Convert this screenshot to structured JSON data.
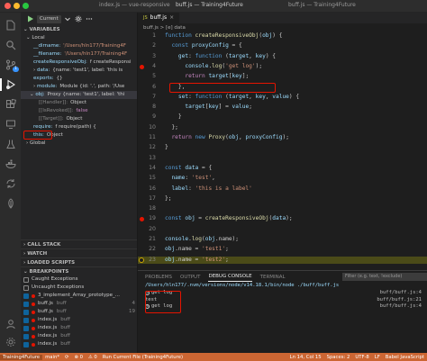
{
  "window": {
    "title_left": "index.js — vue-responsive",
    "title_center": "buff.js — Training4Future",
    "title_right": "buff.js — Training4Future"
  },
  "activity": {
    "items": [
      "files-icon",
      "search-icon",
      "source-control-icon",
      "run-debug-icon",
      "extensions-icon",
      "remote-icon",
      "testing-icon",
      "docker-icon",
      "settings-sync-icon",
      "leaf-icon"
    ],
    "badge": "1"
  },
  "debug_toolbar": {
    "config_label": "Current"
  },
  "variables": {
    "header": "VARIABLES",
    "local_label": "Local",
    "rows": [
      {
        "key": "__dirname:",
        "val": "'/Users/hln177/Training4F"
      },
      {
        "key": "__filename:",
        "val": "'/Users/hln177/Training4F"
      },
      {
        "key": "createResponsiveObj:",
        "val": "f createResponsi"
      },
      {
        "key": "data:",
        "val": "{name: 'test1', label: 'this is"
      },
      {
        "key": "exports:",
        "val": "{}"
      },
      {
        "key": "module:",
        "val": "Module {id: '.', path: '/Use"
      },
      {
        "key": "obj:",
        "val": "Proxy {name: 'test1', label: 'thi"
      },
      {
        "key": "[[Handler]]:",
        "val": "Object"
      },
      {
        "key": "[[IsRevoked]]:",
        "val": "false"
      },
      {
        "key": "[[Target]]:",
        "val": "Object"
      },
      {
        "key": "require:",
        "val": "f require(path) {"
      },
      {
        "key": "this:",
        "val": "Object"
      }
    ],
    "global_label": "Global"
  },
  "sections": {
    "call_stack": "CALL STACK",
    "watch": "WATCH",
    "loaded_scripts": "LOADED SCRIPTS",
    "breakpoints": "BREAKPOINTS"
  },
  "breakpoints": [
    {
      "name": "Caught Exceptions",
      "path": "",
      "line": "",
      "checked": false,
      "dot": false
    },
    {
      "name": "Uncaught Exceptions",
      "path": "",
      "line": "",
      "checked": false,
      "dot": false
    },
    {
      "name": "3_implement_Array_prototype_...",
      "path": "",
      "line": "",
      "checked": true,
      "dot": true
    },
    {
      "name": "buff.js",
      "path": "buff",
      "line": "4",
      "checked": true,
      "dot": true
    },
    {
      "name": "buff.js",
      "path": "buff",
      "line": "19",
      "checked": true,
      "dot": true
    },
    {
      "name": "index.js",
      "path": "buff",
      "line": "",
      "checked": true,
      "dot": true
    },
    {
      "name": "index.js",
      "path": "buff",
      "line": "",
      "checked": true,
      "dot": true
    },
    {
      "name": "index.js",
      "path": "buff",
      "line": "",
      "checked": true,
      "dot": true
    },
    {
      "name": "index.js",
      "path": "buff",
      "line": "",
      "checked": true,
      "dot": true
    }
  ],
  "editor": {
    "tab_label": "buff.js",
    "breadcrumb": "buff.js > [e] data",
    "lines": [
      {
        "n": "1",
        "code": "function createResponsiveObj(obj) {"
      },
      {
        "n": "2",
        "code": "  const proxyConfig = {"
      },
      {
        "n": "3",
        "code": "    get: function (target, key) {"
      },
      {
        "n": "4",
        "code": "      console.log('get log');"
      },
      {
        "n": "5",
        "code": "      return target[key];"
      },
      {
        "n": "6",
        "code": "    },"
      },
      {
        "n": "7",
        "code": "    set: function (target, key, value) {"
      },
      {
        "n": "8",
        "code": "      target[key] = value;"
      },
      {
        "n": "9",
        "code": "    }"
      },
      {
        "n": "10",
        "code": "  };"
      },
      {
        "n": "11",
        "code": "  return new Proxy(obj, proxyConfig);"
      },
      {
        "n": "12",
        "code": "}"
      },
      {
        "n": "13",
        "code": ""
      },
      {
        "n": "14",
        "code": "const data = {"
      },
      {
        "n": "15",
        "code": "  name: 'test',"
      },
      {
        "n": "16",
        "code": "  label: 'this is a label'"
      },
      {
        "n": "17",
        "code": "};"
      },
      {
        "n": "18",
        "code": ""
      },
      {
        "n": "19",
        "code": "const obj = createResponsiveObj(data);"
      },
      {
        "n": "20",
        "code": ""
      },
      {
        "n": "21",
        "code": "console.log(obj.name);"
      },
      {
        "n": "22",
        "code": "obj.name = 'test1';"
      },
      {
        "n": "23",
        "code": "obj.name = 'test2';"
      }
    ]
  },
  "panel": {
    "tabs": [
      "PROBLEMS",
      "OUTPUT",
      "DEBUG CONSOLE",
      "TERMINAL"
    ],
    "filter_placeholder": "Filter (e.g. text, !exclude)",
    "lines": [
      {
        "text": "/Users/hln177/.nvm/versions/node/v14.18.1/bin/node ./buff/buff.js",
        "src": ""
      },
      {
        "text": "get log",
        "src": "buff/buff.js:4",
        "count": "2"
      },
      {
        "text": "test",
        "src": "buff/buff.js:21"
      },
      {
        "text": "get log",
        "src": "buff/buff.js:4",
        "count": "4"
      }
    ]
  },
  "status": {
    "remote": "Training4Future",
    "branch": "main*",
    "sync": "⟳",
    "errors": "⊗ 0",
    "warnings": "⚠ 0",
    "run": "Run Current File (Training4Future)",
    "position": "Ln 14, Col 15",
    "spaces": "Spaces: 2",
    "encoding": "UTF-8",
    "eol": "LF",
    "language": "Babel JavaScript"
  }
}
